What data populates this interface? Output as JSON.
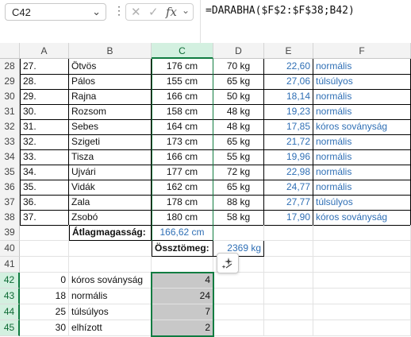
{
  "formula_bar": {
    "name_box": "C42",
    "formula": "=DARABHA($F$2:$F$38;B42)",
    "cancel_icon": "close-icon",
    "enter_icon": "check-icon",
    "function_label": "fx"
  },
  "columns": [
    "A",
    "B",
    "C",
    "D",
    "E",
    "F"
  ],
  "rows": [
    {
      "row": "28",
      "a": "27.",
      "b": "Ötvös",
      "c": "176 cm",
      "d": "70 kg",
      "e": "22,60",
      "f": "normális"
    },
    {
      "row": "29",
      "a": "28.",
      "b": "Pálos",
      "c": "155 cm",
      "d": "65 kg",
      "e": "27,06",
      "f": "túlsúlyos"
    },
    {
      "row": "30",
      "a": "29.",
      "b": "Rajna",
      "c": "166 cm",
      "d": "50 kg",
      "e": "18,14",
      "f": "normális"
    },
    {
      "row": "31",
      "a": "30.",
      "b": "Rozsom",
      "c": "158 cm",
      "d": "48 kg",
      "e": "19,23",
      "f": "normális"
    },
    {
      "row": "32",
      "a": "31.",
      "b": "Sebes",
      "c": "164 cm",
      "d": "48 kg",
      "e": "17,85",
      "f": "kóros soványság"
    },
    {
      "row": "33",
      "a": "32.",
      "b": "Szigeti",
      "c": "173 cm",
      "d": "65 kg",
      "e": "21,72",
      "f": "normális"
    },
    {
      "row": "34",
      "a": "33.",
      "b": "Tisza",
      "c": "166 cm",
      "d": "55 kg",
      "e": "19,96",
      "f": "normális"
    },
    {
      "row": "35",
      "a": "34.",
      "b": "Ujvári",
      "c": "177 cm",
      "d": "72 kg",
      "e": "22,98",
      "f": "normális"
    },
    {
      "row": "36",
      "a": "35.",
      "b": "Vidák",
      "c": "162 cm",
      "d": "65 kg",
      "e": "24,77",
      "f": "normális"
    },
    {
      "row": "37",
      "a": "36.",
      "b": "Zala",
      "c": "178 cm",
      "d": "88 kg",
      "e": "27,77",
      "f": "túlsúlyos"
    },
    {
      "row": "38",
      "a": "37.",
      "b": "Zsobó",
      "c": "180 cm",
      "d": "58 kg",
      "e": "17,90",
      "f": "kóros soványság"
    }
  ],
  "summary": {
    "row39": "39",
    "avg_label": "Átlagmagasság:",
    "avg_value": "166,62 cm",
    "row40": "40",
    "weight_label": "Össztömeg:",
    "weight_value": "2369 kg"
  },
  "category_rows": [
    {
      "row": "41",
      "a": "",
      "b": "",
      "c": ""
    },
    {
      "row": "42",
      "a": "0",
      "b": "kóros soványság",
      "c": "4"
    },
    {
      "row": "43",
      "a": "18",
      "b": "normális",
      "c": "24"
    },
    {
      "row": "44",
      "a": "25",
      "b": "túlsúlyos",
      "c": "7"
    },
    {
      "row": "45",
      "a": "30",
      "b": "elhízott",
      "c": "2"
    }
  ],
  "colors": {
    "accent": "#107c41",
    "link_blue": "#2f6fb5",
    "selection_fill": "#c8c8c8"
  }
}
